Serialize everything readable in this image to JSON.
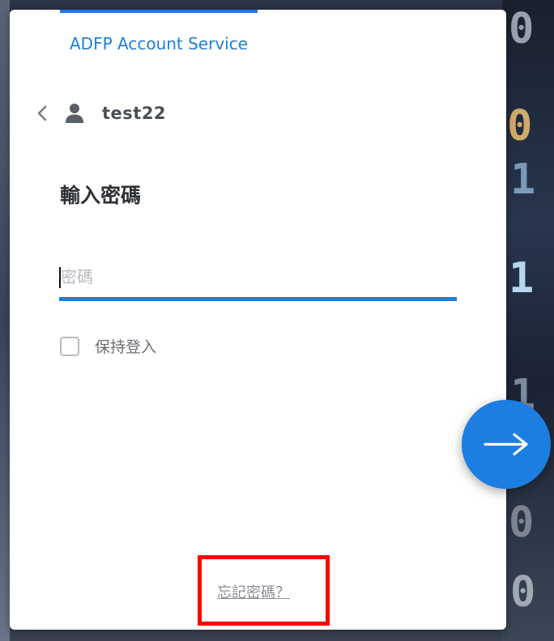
{
  "login": {
    "service_title": "ADFP Account Service",
    "username": "test22",
    "heading": "輸入密碼",
    "password_placeholder": "密碼",
    "password_value": "",
    "remember_label": "保持登入",
    "remember_checked": false,
    "forgot_label": "忘記密碼？"
  },
  "background": {
    "glyphs": [
      "0",
      "0",
      "1",
      "1",
      "1",
      "0",
      "0"
    ]
  },
  "icons": {
    "back": "chevron-left-icon",
    "user": "user-icon",
    "next": "arrow-right-icon"
  },
  "colors": {
    "accent": "#1e7ed6",
    "button": "#1c7ee0",
    "highlight": "#ff0000"
  }
}
